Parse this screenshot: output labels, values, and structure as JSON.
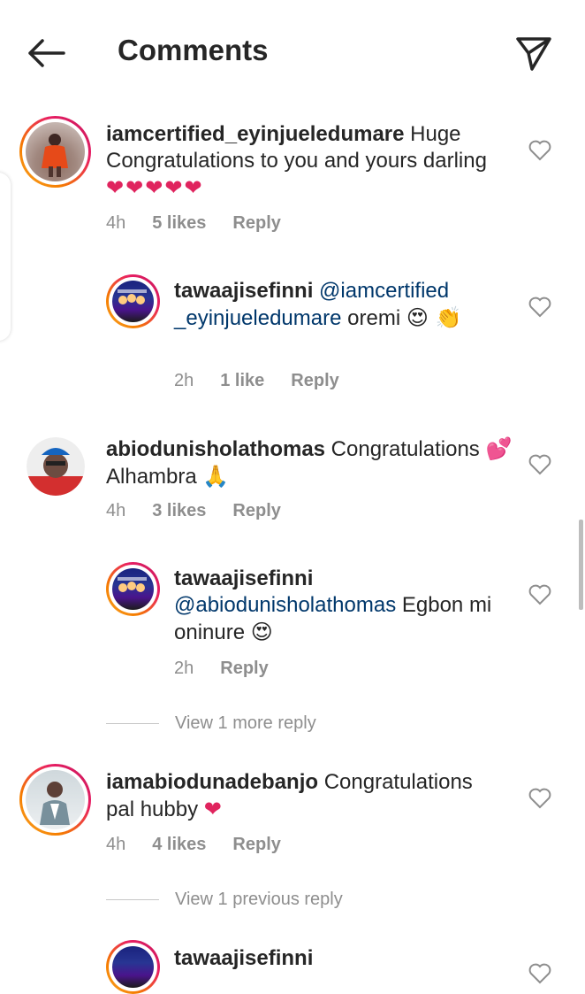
{
  "header": {
    "title": "Comments"
  },
  "comments": [
    {
      "user": "iamcertified_eyinjueledumare",
      "text": " Huge Congratulations to you and yours darling ",
      "emoji": "❤❤❤❤❤",
      "time": "4h",
      "likes": "5 likes",
      "reply": "Reply"
    },
    {
      "user": "tawaajisefinni",
      "mention": " @iamcertified _eyinjueledumare",
      "text": " oremi ",
      "emoji": "😍 👏",
      "time": "2h",
      "likes": "1 like",
      "reply": "Reply"
    },
    {
      "user": "abiodunisholathomas",
      "text": " Congratulations ",
      "emoji_a": "💕",
      "text_b": " Alhambra ",
      "emoji_b": "🙏",
      "time": "4h",
      "likes": "3 likes",
      "reply": "Reply"
    },
    {
      "user": "tawaajisefinni",
      "mention": " @abiodunisholathomas",
      "text": " Egbon mi oninure ",
      "emoji": "😍",
      "time": "2h",
      "reply": "Reply"
    },
    {
      "user": "iamabiodunadebanjo",
      "text": " Congratulations pal hubby ",
      "emoji": "❤",
      "time": "4h",
      "likes": "4 likes",
      "reply": "Reply"
    },
    {
      "user": "tawaajisefinni"
    }
  ],
  "view_more_1": "View 1 more reply",
  "view_previous": "View 1 previous reply",
  "colors": {
    "heart_red": "#e0245e",
    "mention": "#00376b",
    "meta": "#8e8e8e"
  }
}
